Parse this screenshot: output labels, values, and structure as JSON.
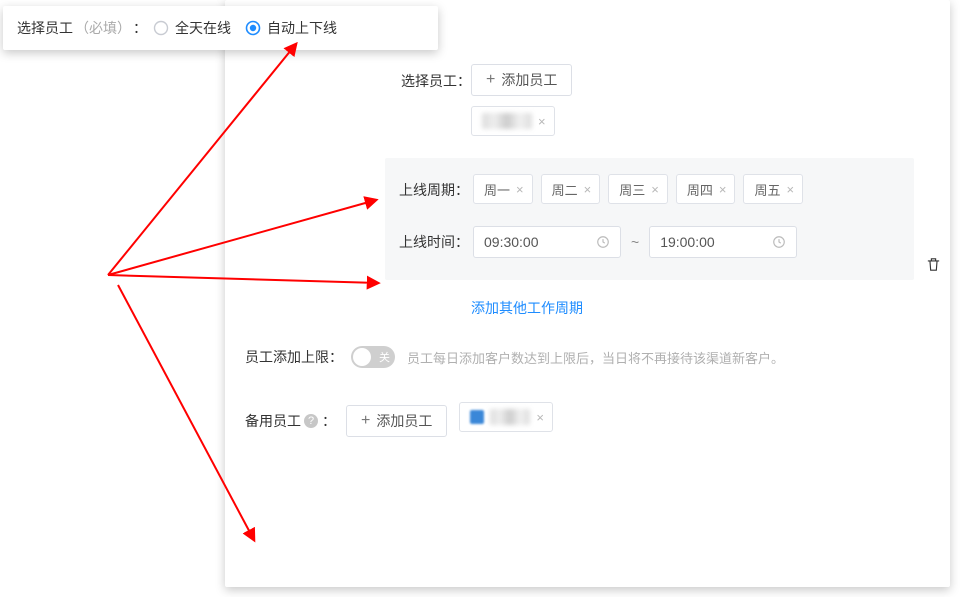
{
  "ribbon": {
    "label": "选择员工",
    "required": "（必填）",
    "colon": "：",
    "option_all_online": "全天在线",
    "option_auto": "自动上下线"
  },
  "employee": {
    "label": "选择员工：",
    "add_btn": "添加员工",
    "selected_name": "███"
  },
  "schedule": {
    "cycle_label": "上线周期：",
    "days": [
      "周一",
      "周二",
      "周三",
      "周四",
      "周五"
    ],
    "time_label": "上线时间：",
    "start": "09:30:00",
    "end": "19:00:00",
    "sep": "~"
  },
  "add_period": "添加其他工作周期",
  "limit": {
    "label": "员工添加上限：",
    "switch_off": "关",
    "hint": "员工每日添加客户数达到上限后，当日将不再接待该渠道新客户。"
  },
  "backup": {
    "label": "备用员工",
    "colon": "：",
    "add_btn": "添加员工",
    "selected_name": "███"
  }
}
